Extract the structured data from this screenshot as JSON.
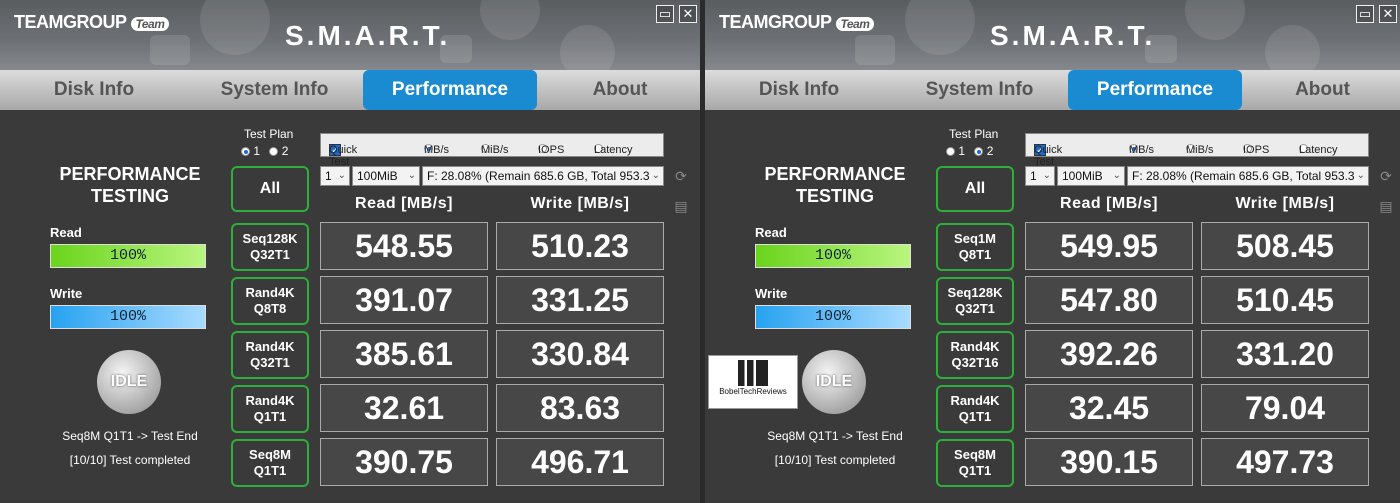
{
  "panels": [
    {
      "logo": "TEAMGROUP",
      "logo_badge": "Team",
      "title": "S.M.A.R.T.",
      "window_controls": [
        "▭",
        "✕"
      ],
      "tabs": [
        "Disk Info",
        "System Info",
        "Performance",
        "About"
      ],
      "active_tab": "Performance",
      "perf_title_line1": "PERFORMANCE",
      "perf_title_line2": "TESTING",
      "read_label": "Read",
      "read_progress": "100%",
      "write_label": "Write",
      "write_progress": "100%",
      "idle_label": "IDLE",
      "status_line1": "Seq8M Q1T1 -> Test End",
      "status_line2": "[10/10] Test completed",
      "test_plan_label": "Test Plan",
      "test_plan_options": [
        "1",
        "2"
      ],
      "test_plan_selected": "1",
      "quick_test_label": "Quick Test",
      "unit_options": [
        "MB/s",
        "MiB/s",
        "IOPS",
        "Latency"
      ],
      "unit_selected": "MB/s",
      "count_select": "1",
      "size_select": "100MiB",
      "drive_select": "F: 28.08% (Remain 685.6 GB, Total 953.3",
      "all_button": "All",
      "read_header": "Read [MB/s]",
      "write_header": "Write [MB/s]",
      "rows": [
        {
          "line1": "Seq128K",
          "line2": "Q32T1",
          "read": "548.55",
          "write": "510.23"
        },
        {
          "line1": "Rand4K",
          "line2": "Q8T8",
          "read": "391.07",
          "write": "331.25"
        },
        {
          "line1": "Rand4K",
          "line2": "Q32T1",
          "read": "385.61",
          "write": "330.84"
        },
        {
          "line1": "Rand4K",
          "line2": "Q1T1",
          "read": "32.61",
          "write": "83.63"
        },
        {
          "line1": "Seq8M",
          "line2": "Q1T1",
          "read": "390.75",
          "write": "496.71"
        }
      ]
    },
    {
      "logo": "TEAMGROUP",
      "logo_badge": "Team",
      "title": "S.M.A.R.T.",
      "window_controls": [
        "▭",
        "✕"
      ],
      "tabs": [
        "Disk Info",
        "System Info",
        "Performance",
        "About"
      ],
      "active_tab": "Performance",
      "perf_title_line1": "PERFORMANCE",
      "perf_title_line2": "TESTING",
      "read_label": "Read",
      "read_progress": "100%",
      "write_label": "Write",
      "write_progress": "100%",
      "idle_label": "IDLE",
      "status_line1": "Seq8M Q1T1 -> Test End",
      "status_line2": "[10/10] Test completed",
      "test_plan_label": "Test Plan",
      "test_plan_options": [
        "1",
        "2"
      ],
      "test_plan_selected": "2",
      "quick_test_label": "Quick Test",
      "unit_options": [
        "MB/s",
        "MiB/s",
        "IOPS",
        "Latency"
      ],
      "unit_selected": "MB/s",
      "count_select": "1",
      "size_select": "100MiB",
      "drive_select": "F: 28.08% (Remain 685.6 GB, Total 953.3",
      "all_button": "All",
      "read_header": "Read [MB/s]",
      "write_header": "Write [MB/s]",
      "rows": [
        {
          "line1": "Seq1M",
          "line2": "Q8T1",
          "read": "549.95",
          "write": "508.45"
        },
        {
          "line1": "Seq128K",
          "line2": "Q32T1",
          "read": "547.80",
          "write": "510.45"
        },
        {
          "line1": "Rand4K",
          "line2": "Q32T16",
          "read": "392.26",
          "write": "331.20"
        },
        {
          "line1": "Rand4K",
          "line2": "Q1T1",
          "read": "32.45",
          "write": "79.04"
        },
        {
          "line1": "Seq8M",
          "line2": "Q1T1",
          "read": "390.15",
          "write": "497.73"
        }
      ]
    }
  ],
  "watermark": "BobelTechReviews",
  "colors": {
    "accent_tab": "#1a8ad1",
    "button_border": "#2fae3a",
    "read_bar": "#6ad41c",
    "write_bar": "#27a2f0"
  }
}
